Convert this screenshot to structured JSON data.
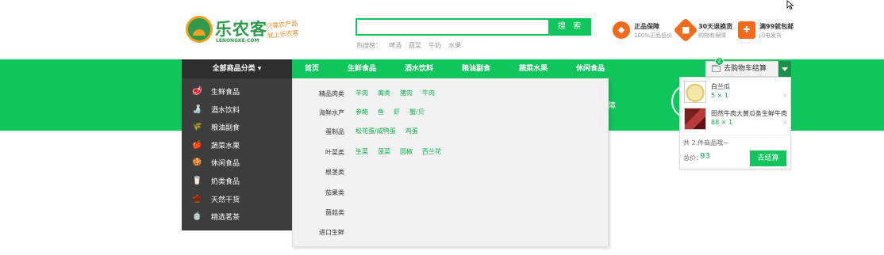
{
  "brand": {
    "name": "乐农客",
    "domain": "LENONGKE.COM",
    "slogan_line1": "只需农产品",
    "slogan_line2": "就上乐农客"
  },
  "search": {
    "value": "",
    "placeholder": "",
    "button_label": "搜 索",
    "hot_label": "热搜榜：",
    "hot_terms": [
      "啤酒",
      "蔬菜",
      "牛奶",
      "水果"
    ]
  },
  "promises": [
    {
      "icon": "diamond-icon",
      "title": "正品保障",
      "subtitle": "100%正品低价"
    },
    {
      "icon": "box-icon",
      "title": "30天退换货",
      "subtitle": "购物有保障"
    },
    {
      "icon": "gift-icon",
      "title": "满99就包邮",
      "subtitle": "闪电发货"
    }
  ],
  "nav": {
    "all_categories": "全部商品分类 ▾",
    "items": [
      "首页",
      "生鲜食品",
      "酒水饮料",
      "粮油副食",
      "蔬菜水果",
      "休闲食品"
    ]
  },
  "cart": {
    "button_label": "去购物车结算",
    "badge_count": "2",
    "items": [
      {
        "name": "白兰瓜",
        "price": "5 × 1",
        "remove": "×"
      },
      {
        "name": "田然牛肉大黄瓜条生鲜牛肉",
        "price": "88 × 1",
        "remove": "×"
      }
    ],
    "summary": "共 2 件商品哦~",
    "total_label": "总价：",
    "total_value": "93",
    "checkout_label": "去结算"
  },
  "banner": {
    "text": "障"
  },
  "categories": [
    {
      "icon": "meat-icon",
      "glyph": "🥩",
      "label": "生鲜食品"
    },
    {
      "icon": "bottle-icon",
      "glyph": "🍶",
      "label": "酒水饮料"
    },
    {
      "icon": "grain-icon",
      "glyph": "🌾",
      "label": "粮油副食"
    },
    {
      "icon": "apple-icon",
      "glyph": "🍎",
      "label": "蔬菜水果"
    },
    {
      "icon": "snack-icon",
      "glyph": "🍪",
      "label": "休闲食品"
    },
    {
      "icon": "milk-icon",
      "glyph": "🥛",
      "label": "奶类食品"
    },
    {
      "icon": "nut-icon",
      "glyph": "🌰",
      "label": "天然干货"
    },
    {
      "icon": "tea-icon",
      "glyph": "🍵",
      "label": "精选茗茶"
    }
  ],
  "mega_menu": [
    {
      "title": "精品肉类",
      "subs": [
        "羊肉",
        "禽类",
        "猪肉",
        "牛肉"
      ]
    },
    {
      "title": "海鲜水产",
      "subs": [
        "参鲍",
        "鱼",
        "虾",
        "蟹/贝"
      ]
    },
    {
      "title": "蛋制品",
      "subs": [
        "松花蛋/咸鸭蛋",
        "鸡蛋"
      ]
    },
    {
      "title": "叶菜类",
      "subs": [
        "生菜",
        "菠菜",
        "圆椒",
        "西兰花"
      ]
    },
    {
      "title": "根茎类",
      "subs": []
    },
    {
      "title": "茄果类",
      "subs": []
    },
    {
      "title": "菌菇类",
      "subs": []
    },
    {
      "title": "进口生鲜",
      "subs": []
    }
  ],
  "colors": {
    "primary": "#10c55b",
    "dark_sidebar": "#3d3d3d",
    "accent_orange": "#f26a1b"
  }
}
